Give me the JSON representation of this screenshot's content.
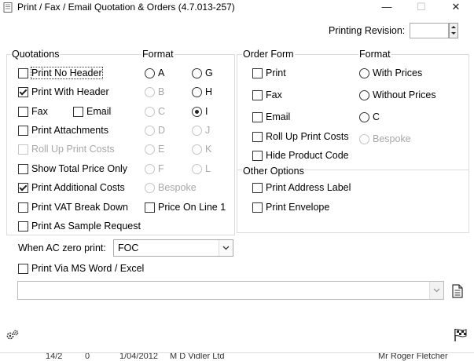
{
  "window": {
    "title": "Print / Fax / Email Quotation & Orders (4.7.013-257)",
    "minimize": "—",
    "maximize": "☐",
    "close": "✕"
  },
  "printing_revision": {
    "label": "Printing Revision:",
    "value": ""
  },
  "quotations": {
    "title": "Quotations",
    "format_title": "Format",
    "print_no_header": "Print No Header",
    "print_with_header": "Print With Header",
    "fax": "Fax",
    "email": "Email",
    "print_attachments": "Print Attachments",
    "roll_up_print_costs": "Roll Up Print Costs",
    "show_total_price_only": "Show Total Price Only",
    "print_additional_costs": "Print Additional Costs",
    "print_vat_break_down": "Print VAT Break Down",
    "price_on_line_1": "Price On Line 1",
    "print_as_sample_request": "Print As Sample Request",
    "formats": {
      "A": "A",
      "B": "B",
      "C": "C",
      "D": "D",
      "E": "E",
      "F": "F",
      "G": "G",
      "H": "H",
      "I": "I",
      "J": "J",
      "K": "K",
      "L": "L",
      "bespoke": "Bespoke"
    }
  },
  "order_form": {
    "title": "Order Form",
    "format_title": "Format",
    "print": "Print",
    "fax": "Fax",
    "email": "Email",
    "roll_up_print_costs": "Roll Up Print Costs",
    "hide_product_code": "Hide Product Code",
    "with_prices": "With Prices",
    "without_prices": "Without Prices",
    "c": "C",
    "bespoke": "Bespoke"
  },
  "other_options": {
    "title": "Other Options",
    "print_address_label": "Print Address Label",
    "print_envelope": "Print Envelope"
  },
  "ac_zero": {
    "label": "When AC zero print:",
    "value": "FOC"
  },
  "print_via_word": "Print Via MS Word / Excel",
  "file_combo": {
    "value": ""
  },
  "background_row": {
    "c1": "14/2",
    "c2": "0",
    "c3": "1/04/2012",
    "c4": "M D Vidler Ltd",
    "c5": "Mr Roger Fletcher"
  },
  "colors": {
    "border": "#dcdcdc",
    "disabled": "#a8a8a8"
  }
}
